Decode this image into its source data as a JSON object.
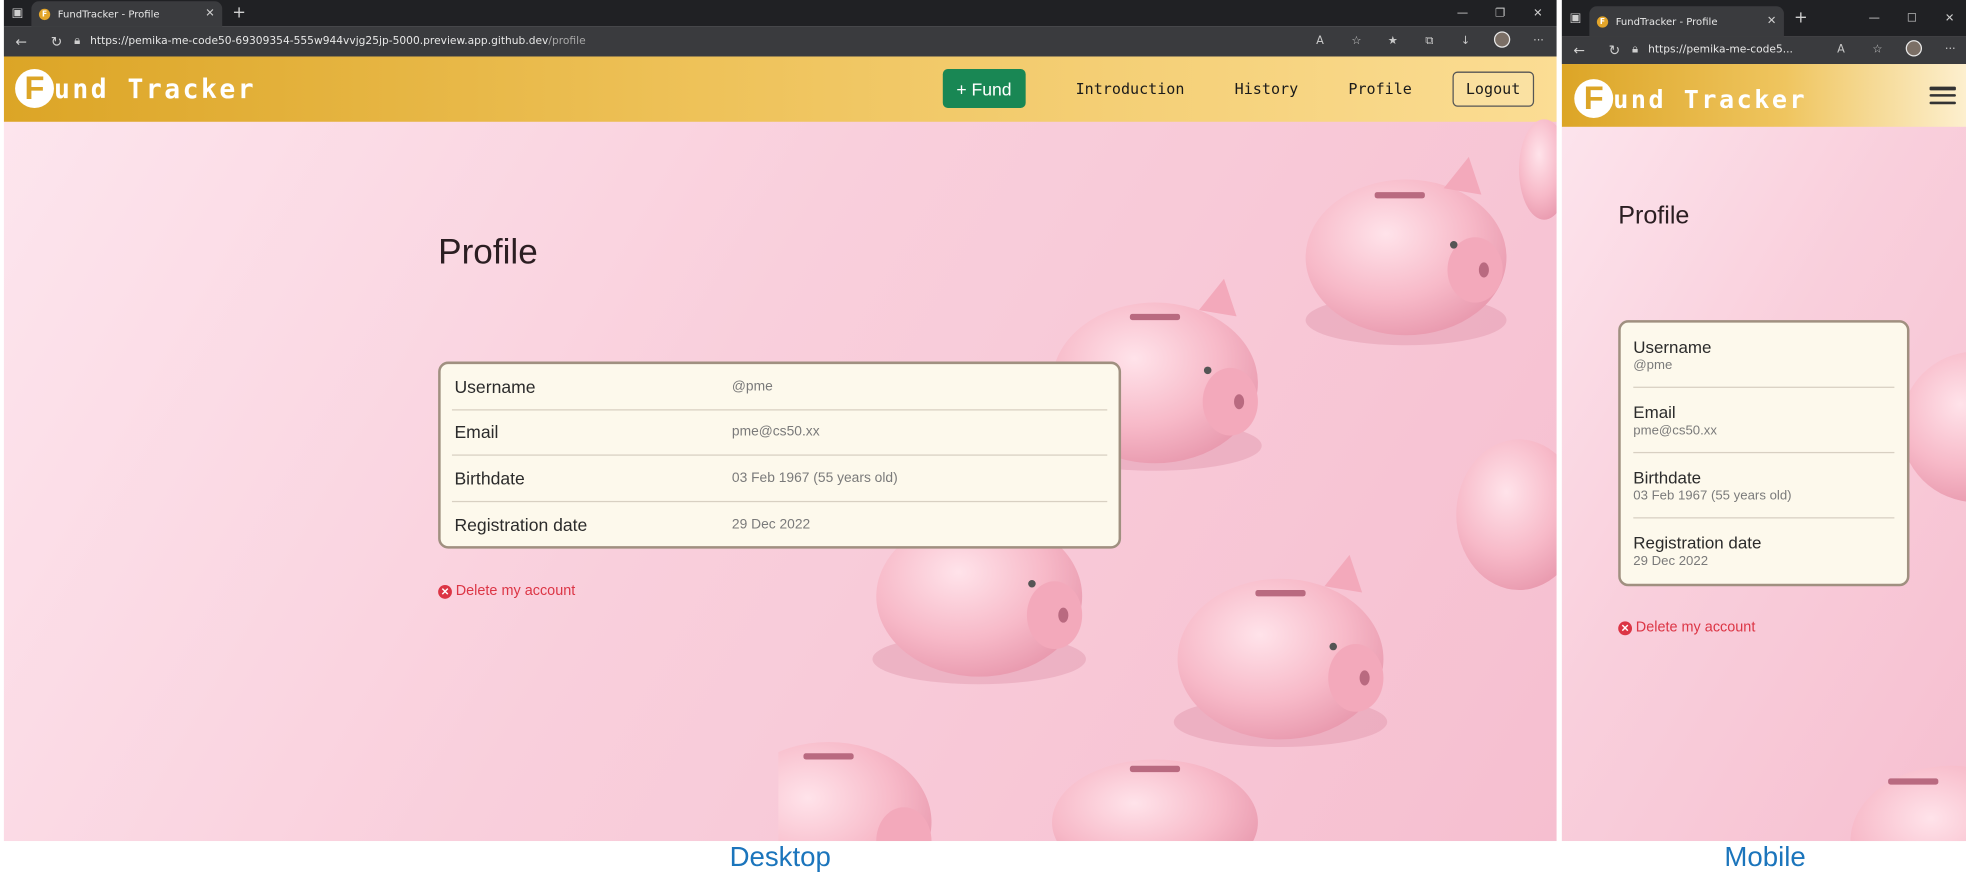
{
  "browser": {
    "tab_title": "FundTracker - Profile",
    "favicon_letter": "F",
    "url_host": "https://pemika-me-code50-69309354-555w944vvjg25jp-5000.preview.app.github.dev",
    "url_path": "/profile",
    "url_short": "https://pemika-me-code5..."
  },
  "navbar": {
    "brand_letter": "F",
    "brand_rest": "und Tracker",
    "fund_button": "+ Fund",
    "links": [
      "Introduction",
      "History",
      "Profile"
    ],
    "logout": "Logout"
  },
  "profile": {
    "title": "Profile",
    "rows": [
      {
        "label": "Username",
        "value": "@pme"
      },
      {
        "label": "Email",
        "value": "pme@cs50.xx"
      },
      {
        "label": "Birthdate",
        "value": "03 Feb 1967 (55 years old)"
      },
      {
        "label": "Registration date",
        "value": "29 Dec 2022"
      }
    ],
    "delete_label": "Delete my account"
  },
  "captions": {
    "desktop": "Desktop",
    "mobile": "Mobile"
  },
  "colors": {
    "navbar_gold": "#dca526",
    "fund_green": "#198754",
    "danger_red": "#dc3545",
    "caption_blue": "#1b75bc",
    "page_pink": "#f9cfdc"
  },
  "icons": {
    "tab_close": "close-icon",
    "new_tab": "plus-icon",
    "back": "arrow-left-icon",
    "refresh": "refresh-icon",
    "lock": "lock-icon",
    "menu": "hamburger-icon",
    "delete": "x-circle-icon"
  }
}
